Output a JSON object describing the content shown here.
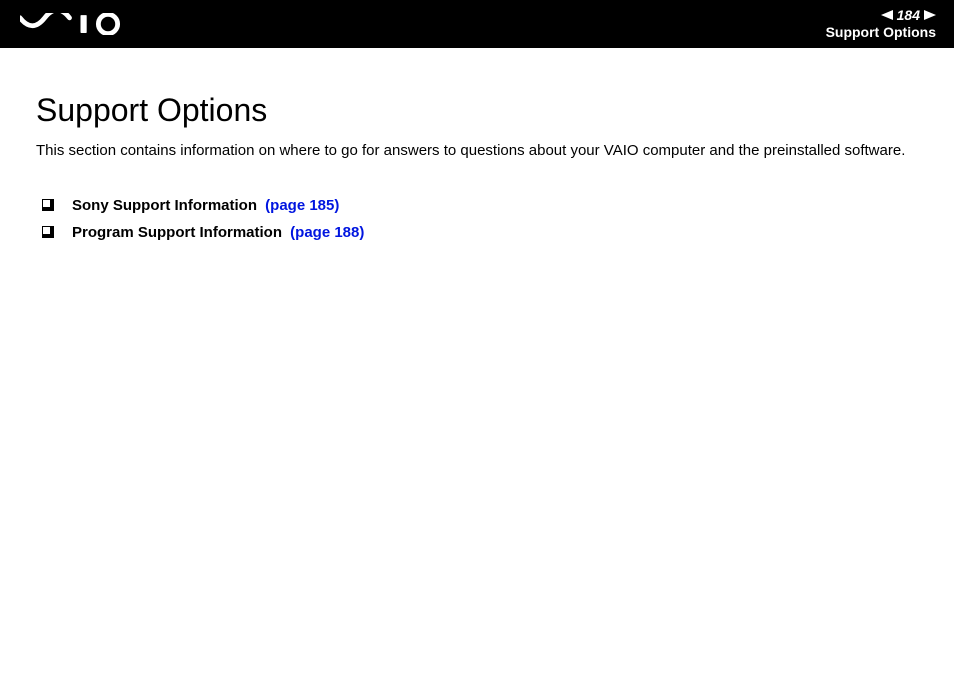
{
  "header": {
    "page_number": "184",
    "section_label": "Support Options"
  },
  "main": {
    "title": "Support Options",
    "intro": "This section contains information on where to go for answers to questions about your VAIO computer and the preinstalled software.",
    "links": [
      {
        "title": "Sony Support Information",
        "page_ref": "(page 185)"
      },
      {
        "title": "Program Support Information",
        "page_ref": "(page 188)"
      }
    ]
  }
}
